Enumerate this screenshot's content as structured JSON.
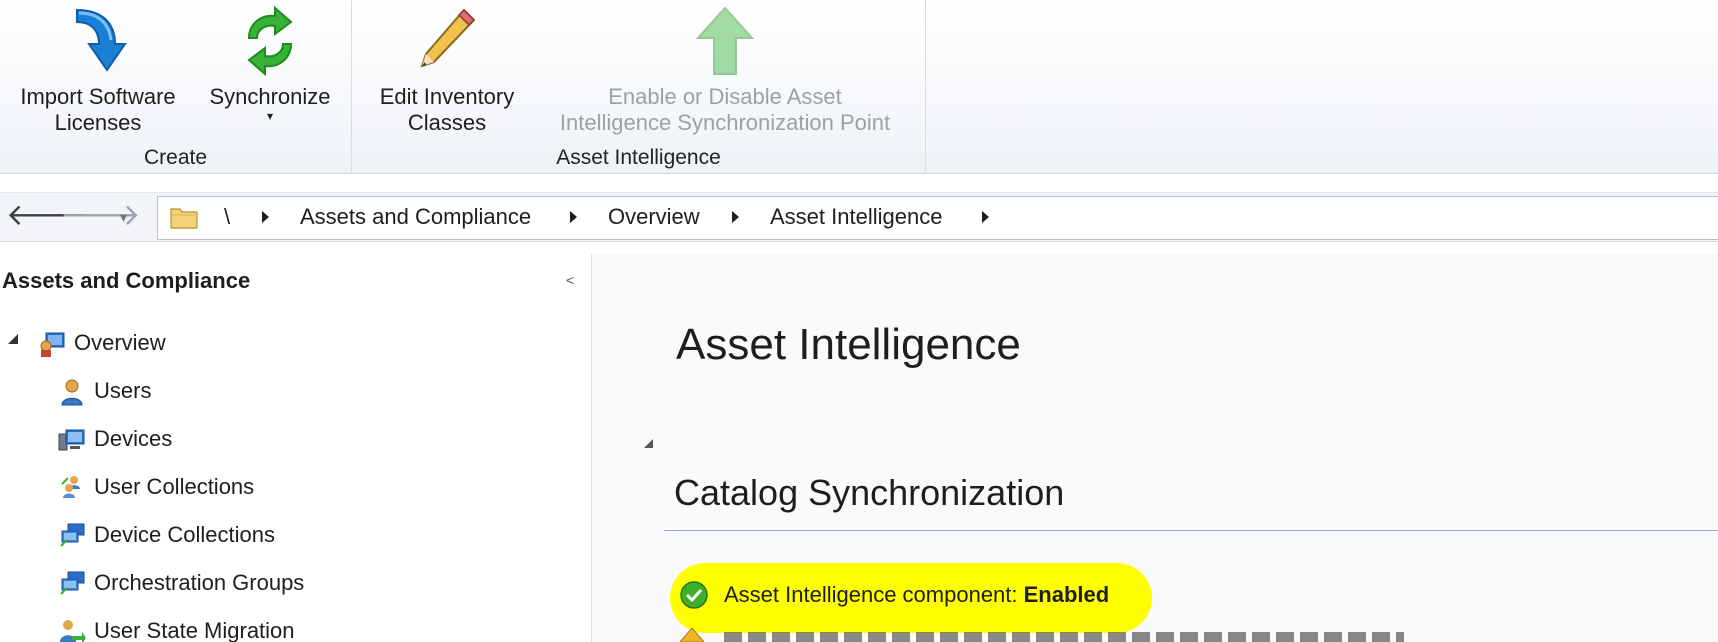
{
  "ribbon": {
    "groups": [
      {
        "label": "Create",
        "buttons": [
          {
            "label": "Import Software\nLicenses",
            "icon": "import-arrow-icon",
            "enabled": true
          },
          {
            "label": "Synchronize",
            "icon": "synchronize-icon",
            "enabled": true,
            "has_dropdown": true,
            "dropdown_glyph": "▾"
          }
        ]
      },
      {
        "label": "Asset Intelligence",
        "buttons": [
          {
            "label": "Edit Inventory\nClasses",
            "icon": "pencil-icon",
            "enabled": true
          },
          {
            "label": "Enable or Disable Asset\nIntelligence Synchronization Point",
            "icon": "up-arrow-icon",
            "enabled": false
          }
        ]
      }
    ]
  },
  "navigation": {
    "back_glyph": "🡐",
    "forward_glyph": "🡒",
    "dropdown_glyph": "▾",
    "breadcrumb": [
      "\\",
      "Assets and Compliance",
      "Overview",
      "Asset Intelligence"
    ]
  },
  "sidebar": {
    "title": "Assets and Compliance",
    "collapse_glyph": "<",
    "items": [
      {
        "label": "Overview",
        "icon": "overview-icon",
        "level": 0,
        "expanded": true
      },
      {
        "label": "Users",
        "icon": "user-icon",
        "level": 1
      },
      {
        "label": "Devices",
        "icon": "devices-icon",
        "level": 1
      },
      {
        "label": "User Collections",
        "icon": "user-collections-icon",
        "level": 1
      },
      {
        "label": "Device Collections",
        "icon": "device-collections-icon",
        "level": 1
      },
      {
        "label": "Orchestration Groups",
        "icon": "orchestration-groups-icon",
        "level": 1
      },
      {
        "label": "User State Migration",
        "icon": "user-state-migration-icon",
        "level": 1
      }
    ]
  },
  "main": {
    "title": "Asset Intelligence",
    "section": {
      "title": "Catalog Synchronization",
      "status_label": "Asset Intelligence component: ",
      "status_value": "Enabled",
      "status_icon": "green-check-icon"
    }
  },
  "colors": {
    "highlight": "#ffff00",
    "accent_blue": "#1c7fd6",
    "accent_green": "#36b336",
    "disabled_text": "#9aa1aa"
  }
}
